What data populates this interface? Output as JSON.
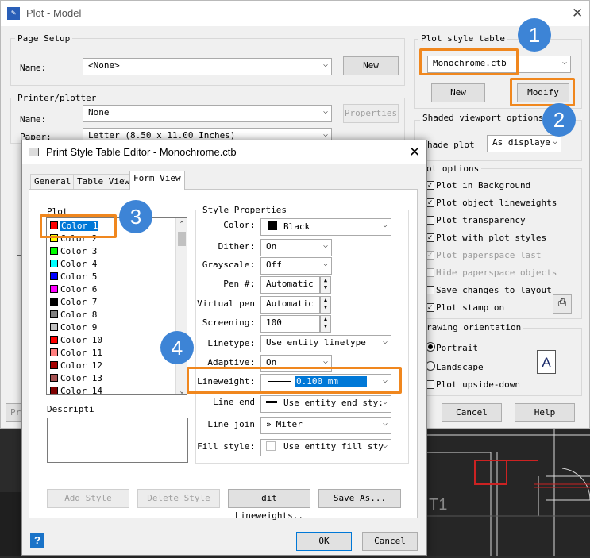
{
  "plot_dialog": {
    "title": "Plot - Model",
    "page_setup": {
      "group": "Page Setup",
      "name_label": "Name:",
      "name_value": "<None>",
      "new_label": "New"
    },
    "printer": {
      "group": "Printer/plotter",
      "name_label": "Name:",
      "name_value": "None",
      "properties_label": "Properties",
      "paper_label": "Paper:",
      "paper_value": "Letter (8.50 x 11.00 Inches)"
    },
    "plot_style_table": {
      "group": "Plot style table",
      "value": "Monochrome.ctb",
      "new_label": "New",
      "modify_label": "Modify"
    },
    "shaded": {
      "group": "Shaded viewport options",
      "shade_plot_label": "hade plot",
      "shade_plot_value": "As displaye"
    },
    "plot_options": {
      "group": "ot options",
      "items": [
        {
          "label": "Plot in Background",
          "checked": true,
          "enabled": true
        },
        {
          "label": "Plot object lineweights",
          "checked": true,
          "enabled": true
        },
        {
          "label": "Plot transparency",
          "checked": false,
          "enabled": true
        },
        {
          "label": "Plot with plot styles",
          "checked": true,
          "enabled": true
        },
        {
          "label": "Plot paperspace last",
          "checked": true,
          "enabled": false
        },
        {
          "label": "Hide paperspace objects",
          "checked": false,
          "enabled": false
        },
        {
          "label": "Save changes to layout",
          "checked": false,
          "enabled": true
        },
        {
          "label": "Plot stamp on",
          "checked": true,
          "enabled": true
        }
      ]
    },
    "orientation": {
      "group": "rawing orientation",
      "portrait": "Portrait",
      "landscape": "Landscape",
      "upside_down": "Plot upside-down",
      "selected": "Portrait",
      "icon_letter": "A"
    },
    "cancel_label": "Cancel",
    "help_label": "Help",
    "bottom_left_label": "Pr"
  },
  "editor": {
    "title": "Print Style Table Editor - Monochrome.ctb",
    "tabs": [
      {
        "label": "General"
      },
      {
        "label": "Table View"
      },
      {
        "label": "Form View"
      }
    ],
    "active_tab": "Form View",
    "plot_styles_label": "Plot",
    "styles": [
      {
        "label": "Color 1",
        "color": "#ff0000"
      },
      {
        "label": "Color 2",
        "color": "#ffff00"
      },
      {
        "label": "Color 3",
        "color": "#00ff00"
      },
      {
        "label": "Color 4",
        "color": "#00ffff"
      },
      {
        "label": "Color 5",
        "color": "#0000ff"
      },
      {
        "label": "Color 6",
        "color": "#ff00ff"
      },
      {
        "label": "Color 7",
        "color": "#000000"
      },
      {
        "label": "Color 8",
        "color": "#808080"
      },
      {
        "label": "Color 9",
        "color": "#c0c0c0"
      },
      {
        "label": "Color 10",
        "color": "#ff0000"
      },
      {
        "label": "Color 11",
        "color": "#ff7f7f"
      },
      {
        "label": "Color 12",
        "color": "#a50000"
      },
      {
        "label": "Color 13",
        "color": "#a55252"
      },
      {
        "label": "Color 14",
        "color": "#7f0000"
      }
    ],
    "selected_style": "Color 1",
    "description_label": "Descripti",
    "style_properties": {
      "group": "Style Properties",
      "color_label": "Color:",
      "color_value": "Black",
      "color_swatch": "#000000",
      "dither_label": "Dither:",
      "dither_value": "On",
      "grayscale_label": "Grayscale:",
      "grayscale_value": "Off",
      "pen_label": "Pen #:",
      "pen_value": "Automatic",
      "virtual_pen_label": "Virtual pen",
      "virtual_pen_value": "Automatic",
      "screening_label": "Screening:",
      "screening_value": "100",
      "linetype_label": "Linetype:",
      "linetype_value": "Use entity linetype",
      "adaptive_label": "Adaptive:",
      "adaptive_value": "On",
      "lineweight_label": "Lineweight:",
      "lineweight_value": "0.100 mm",
      "line_end_label": "Line end",
      "line_end_value": "Use entity end sty:",
      "line_join_label": "Line join",
      "line_join_value": "Miter",
      "fill_style_label": "Fill style:",
      "fill_style_value": "Use entity fill sty"
    },
    "add_style_label": "Add Style",
    "delete_style_label": "Delete Style",
    "edit_lineweights_label": "dit Lineweights..",
    "save_as_label": "Save As...",
    "ok_label": "OK",
    "cancel_label": "Cancel"
  },
  "callouts": [
    "1",
    "2",
    "3",
    "4"
  ],
  "colors": {
    "highlight": "#f0871e",
    "badge": "#3d84d6",
    "selection": "#0078d7"
  }
}
